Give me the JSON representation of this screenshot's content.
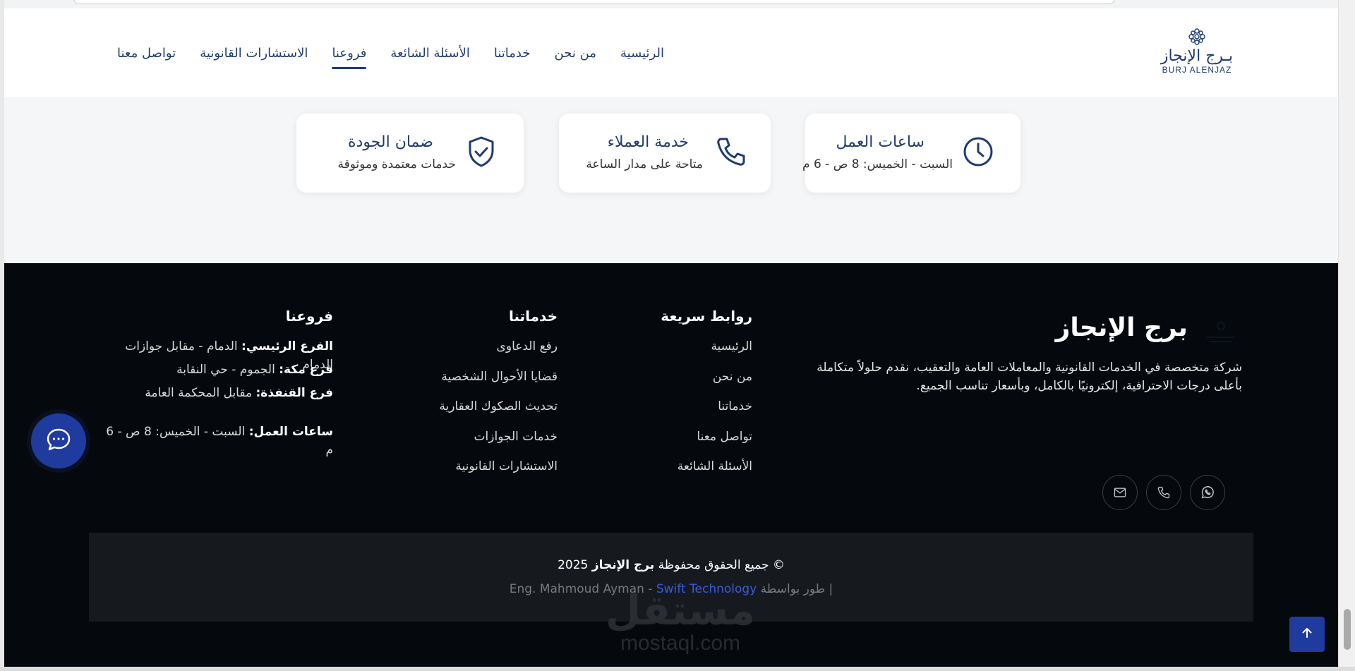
{
  "header": {
    "logo": {
      "ar": "بـرج الإنجاز",
      "en": "BURJ ALENJAZ"
    },
    "nav": [
      {
        "label": "الرئيسية"
      },
      {
        "label": "من نحن"
      },
      {
        "label": "خدماتنا"
      },
      {
        "label": "الأسئلة الشائعة"
      },
      {
        "label": "فروعنا",
        "active": true
      },
      {
        "label": "الاستشارات القانونية"
      },
      {
        "label": "تواصل معنا"
      }
    ]
  },
  "features": [
    {
      "icon": "clock-icon",
      "title": "ساعات العمل",
      "subtitle": "السبت - الخميس: 8 ص - 6 م"
    },
    {
      "icon": "phone-icon",
      "title": "خدمة العملاء",
      "subtitle": "متاحة على مدار الساعة"
    },
    {
      "icon": "shield-check-icon",
      "title": "ضمان الجودة",
      "subtitle": "خدمات معتمدة وموثوقة"
    }
  ],
  "footer": {
    "brand": {
      "title": "برج الإنجاز",
      "description": "شركة متخصصة في الخدمات القانونية والمعاملات العامة والتعقيب، نقدم حلولاً متكاملة بأعلى درجات الاحترافية، إلكترونيًا بالكامل، وبأسعار تناسب الجميع."
    },
    "socials": [
      "whatsapp-icon",
      "phone-icon",
      "email-icon"
    ],
    "quick_links": {
      "title": "روابط سريعة",
      "items": [
        "الرئيسية",
        "من نحن",
        "خدماتنا",
        "تواصل معنا",
        "الأسئلة الشائعة"
      ]
    },
    "services": {
      "title": "خدماتنا",
      "items": [
        "رفع الدعاوى",
        "قضايا الأحوال الشخصية",
        "تحديث الصكوك العقارية",
        "خدمات الجوازات",
        "الاستشارات القانونية"
      ]
    },
    "branches": {
      "title": "فروعنا",
      "rows": [
        {
          "label": "الفرع الرئيسي:",
          "value": "الدمام - مقابل جوازات الدمام"
        },
        {
          "label": "فرع مكة:",
          "value": "الجموم - حي النقابة"
        },
        {
          "label": "فرع القنفذة:",
          "value": "مقابل المحكمة العامة"
        }
      ],
      "hours": {
        "label": "ساعات العمل:",
        "value": "السبت - الخميس: 8 ص - 6 م"
      }
    },
    "copyright": {
      "prefix": "© جميع الحقوق محفوظة",
      "brand": "برج الإنجاز",
      "year": "2025",
      "credit_prefix": "| طور بواسطة Eng. Mahmoud Ayman -",
      "credit_company": "Swift Technology"
    }
  },
  "watermark": {
    "ar": "مستقل",
    "en": "mostaql.com"
  },
  "colors": {
    "primary": "#1f3b72",
    "button": "#1f3b9d",
    "footer_bg": "#05090d",
    "link": "#3a5bd9"
  }
}
